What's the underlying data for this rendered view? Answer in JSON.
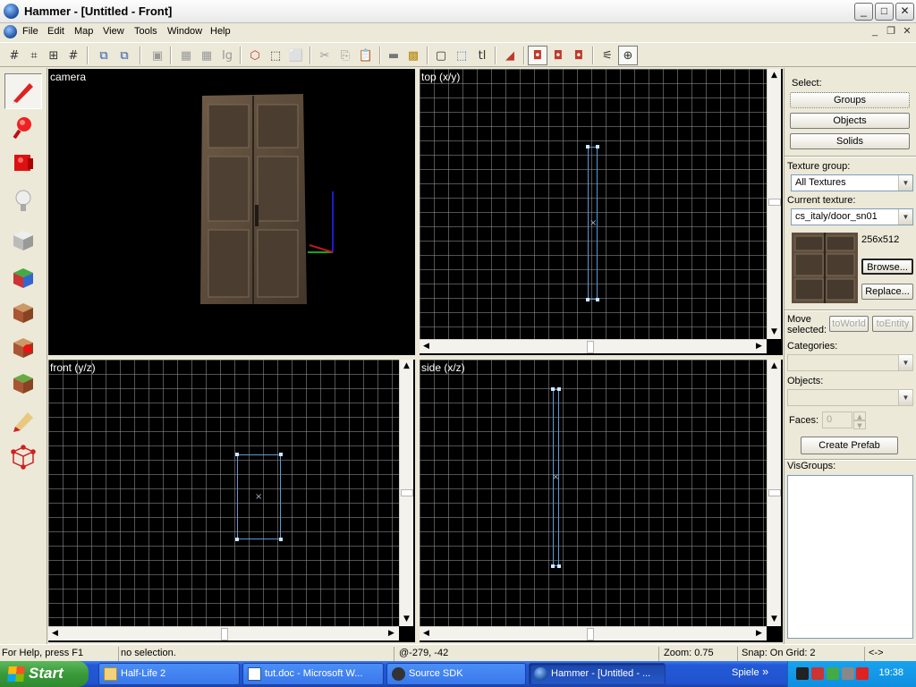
{
  "window": {
    "title": "Hammer - [Untitled - Front]",
    "controls": {
      "minimize": "_",
      "maximize": "□",
      "close": "✕"
    }
  },
  "menu": {
    "items": [
      "File",
      "Edit",
      "Map",
      "View",
      "Tools",
      "Window",
      "Help"
    ],
    "mdi_controls": {
      "minimize": "_",
      "restore": "❐",
      "close": "✕"
    }
  },
  "viewports": {
    "camera": {
      "label": "camera"
    },
    "top": {
      "label": "top (x/y)"
    },
    "front": {
      "label": "front (y/z)"
    },
    "side": {
      "label": "side (x/z)"
    }
  },
  "right_panel": {
    "select_label": "Select:",
    "select_buttons": [
      "Groups",
      "Objects",
      "Solids"
    ],
    "texture_group_label": "Texture group:",
    "texture_group_value": "All Textures",
    "current_texture_label": "Current texture:",
    "current_texture_value": "cs_italy/door_sn01",
    "texture_size": "256x512",
    "browse_button": "Browse...",
    "replace_button": "Replace...",
    "move_selected_label": "Move selected:",
    "to_world_button": "toWorld",
    "to_entity_button": "toEntity",
    "categories_label": "Categories:",
    "objects_label": "Objects:",
    "faces_label": "Faces:",
    "faces_value": "0",
    "create_prefab_button": "Create Prefab",
    "visgroups_label": "VisGroups:"
  },
  "status": {
    "help": "For Help, press F1",
    "selection": "no selection.",
    "coords": "@-279, -42",
    "zoom": "Zoom: 0.75",
    "snap": "Snap: On Grid: 2",
    "extra": "<->"
  },
  "taskbar": {
    "start": "Start",
    "tasks": [
      "Half-Life 2",
      "tut.doc - Microsoft W...",
      "Source SDK",
      "Hammer - [Untitled - ..."
    ],
    "quick_launch": "Spiele",
    "quick_more": "»",
    "clock": "19:38"
  },
  "colors": {
    "viewport_bg": "#000000",
    "grid_line": "#969696",
    "brush_outline": "#5a9bd8",
    "taskbar_blue": "#2457d4",
    "tray_blue": "#0f8fe0"
  }
}
